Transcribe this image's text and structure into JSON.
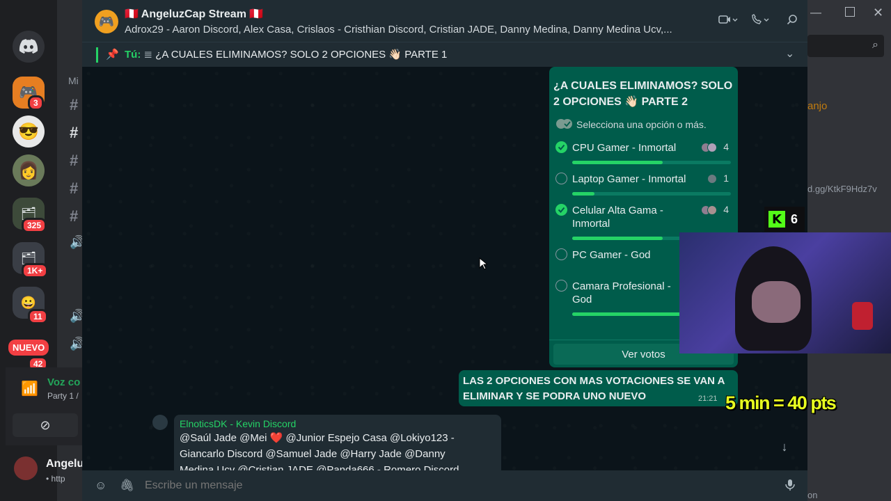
{
  "discord": {
    "rail_badges": [
      "3",
      "325",
      "1K+",
      "11",
      "42"
    ],
    "new_badge": "NUEVO",
    "server_section": "Mi",
    "voice": {
      "label": "Voz co",
      "sub": "Party 1 /"
    },
    "user": {
      "name": "Angelu",
      "status": "• http"
    },
    "right_text": {
      "anjo": "anjo",
      "invite": "d.gg/KtkF9Hdz7v",
      "bottom": "on"
    }
  },
  "chat": {
    "title": "🇵🇪 AngeluzCap Stream 🇵🇪",
    "members": "Adrox29 - Aaron Discord, Alex Casa, Crislaos - Cristhian Discord, Cristian JADE, Danny Medina, Danny Medina Ucv,...",
    "pinned": {
      "sender": "Tú:",
      "text": "¿A CUALES ELIMINAMOS? SOLO 2 OPCIONES 👋🏻 PARTE 1"
    }
  },
  "poll": {
    "question": "¿A CUALES ELIMINAMOS? SOLO 2 OPCIONES 👋🏻 PARTE 2",
    "hint": "Selecciona una opción o más.",
    "options": [
      {
        "label": "CPU Gamer - Inmortal",
        "count": "4",
        "checked": true,
        "fill": 0.57
      },
      {
        "label": "Laptop Gamer - Inmortal",
        "count": "1",
        "checked": false,
        "fill": 0.14
      },
      {
        "label": "Celular Alta Gama - Inmortal",
        "count": "4",
        "checked": true,
        "fill": 0.57
      },
      {
        "label": "PC Gamer - God",
        "count": "",
        "checked": false,
        "fill": 0
      },
      {
        "label": "Camara Profesional - God",
        "count": "",
        "checked": false,
        "fill": 0.9
      }
    ],
    "view_votes": "Ver votos"
  },
  "message_out": {
    "text": "LAS 2 OPCIONES CON MAS VOTACIONES SE VAN A ELIMINAR Y SE PODRA UNO NUEVO",
    "time": "21:21"
  },
  "message_in": {
    "sender": "ElnoticsDK - Kevin Discord",
    "text": "@Saúl Jade @Mei ❤️ @Junior Espejo Casa @Lokiyo123 - Giancarlo Discord @Samuel Jade @Harry Jade @Danny Medina Ucv @Cristian JADE @Panda666 - Romero Discord"
  },
  "composer": {
    "placeholder": "Escribe un mensaje"
  },
  "overlay": {
    "kick_count": "6",
    "points": "5 min = 40 pts"
  },
  "colors": {
    "accent": "#25d366",
    "bubble_out": "#005c4b",
    "header": "#202c33",
    "kick_green": "#53fc18"
  }
}
